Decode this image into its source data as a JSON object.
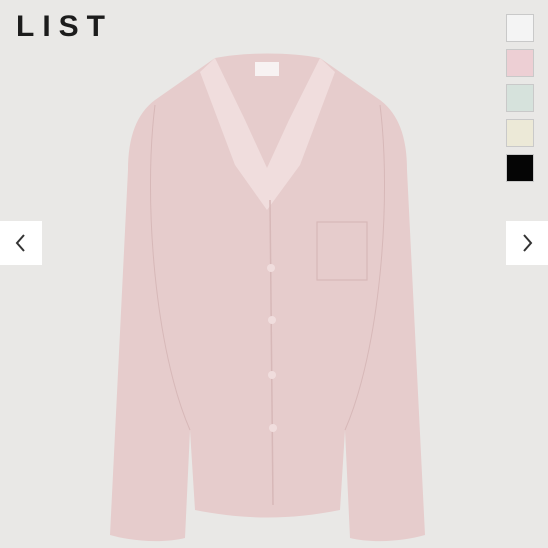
{
  "brand": {
    "name": "LIST"
  },
  "swatches": [
    {
      "name": "white",
      "color": "#f4f4f4"
    },
    {
      "name": "pink",
      "color": "#edcfd4"
    },
    {
      "name": "mint",
      "color": "#d6e2dc"
    },
    {
      "name": "cream",
      "color": "#ece9d7"
    },
    {
      "name": "black",
      "color": "#050505"
    }
  ],
  "product": {
    "color": "#e6cccc",
    "shade": "#d7b8b8",
    "highlight": "#f0dddd"
  },
  "icons": {
    "prev": "chevron-left-icon",
    "next": "chevron-right-icon"
  }
}
